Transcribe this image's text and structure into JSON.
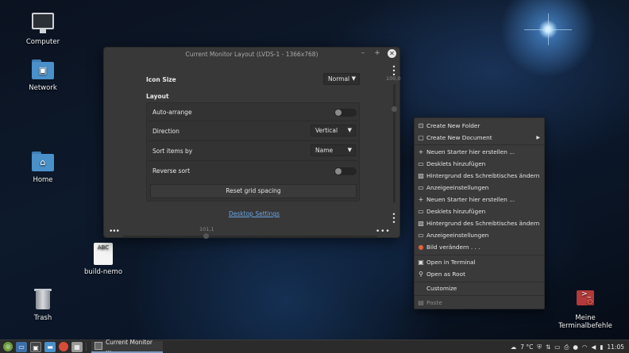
{
  "desktop": {
    "icons": [
      {
        "label": "Computer"
      },
      {
        "label": "Network"
      },
      {
        "label": "Home"
      },
      {
        "label": "build-nemo",
        "doc_text": "ABC"
      },
      {
        "label": "Trash"
      },
      {
        "label": "Meine Terminalbefehle",
        "line1": "Meine",
        "line2": "Terminalbefehle"
      }
    ]
  },
  "dialog": {
    "title": "Current Monitor Layout (LVDS-1 - 1366x768)",
    "controls": {
      "minimize": "–",
      "maximize": "+",
      "close": "✕"
    },
    "icon_size": {
      "label": "Icon Size",
      "value": "Normal"
    },
    "layout_heading": "Layout",
    "auto_arrange": {
      "label": "Auto-arrange",
      "enabled": false
    },
    "direction": {
      "label": "Direction",
      "value": "Vertical"
    },
    "sort_by": {
      "label": "Sort items by",
      "value": "Name"
    },
    "reverse_sort": {
      "label": "Reverse sort",
      "enabled": false
    },
    "reset_button": "Reset grid spacing",
    "settings_link": "Desktop Settings",
    "vscroll_value": "100,0",
    "hscroll_value": "101,1"
  },
  "context_menu": {
    "items": [
      {
        "icon": "new-folder-icon",
        "label": "Create New Folder"
      },
      {
        "icon": "new-document-icon",
        "label": "Create New Document",
        "submenu": true
      },
      {
        "icon": "plus-icon",
        "label": "Neuen Starter hier erstellen ..."
      },
      {
        "icon": "desklet-icon",
        "label": "Desklets hinzufügen"
      },
      {
        "icon": "wallpaper-icon",
        "label": "Hintergrund des Schreibtisches ändern"
      },
      {
        "icon": "display-icon",
        "label": "Anzeigeeinstellungen"
      },
      {
        "icon": "plus-icon",
        "label": "Neuen Starter hier erstellen ..."
      },
      {
        "icon": "desklet-icon",
        "label": "Desklets hinzufügen"
      },
      {
        "icon": "wallpaper-icon",
        "label": "Hintergrund des Schreibtisches ändern"
      },
      {
        "icon": "display-icon",
        "label": "Anzeigeeinstellungen"
      },
      {
        "icon": "edit-image-icon",
        "label": "Bild verändern . . ."
      },
      {
        "icon": "terminal-icon",
        "label": "Open in Terminal"
      },
      {
        "icon": "root-key-icon",
        "label": "Open as Root"
      },
      {
        "icon": "",
        "label": "Customize"
      },
      {
        "icon": "paste-icon",
        "label": "Paste",
        "disabled": true
      }
    ]
  },
  "taskbar": {
    "window_label": "Current Monitor ...",
    "weather": "7 °C",
    "time": "11:05"
  },
  "colors": {
    "accent_link": "#6aa6e8",
    "dialog_bg": "#383838",
    "menu_bg": "#3a3a3a",
    "taskbar_bg": "#2b2b2b"
  }
}
